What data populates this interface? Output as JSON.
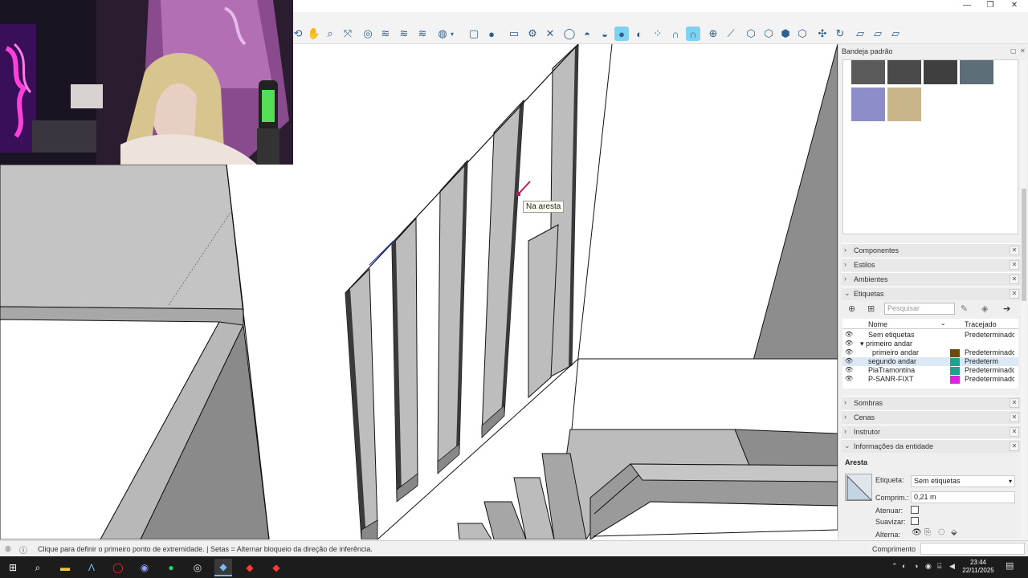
{
  "window": {
    "minimize_glyph": "—",
    "restore_glyph": "❐",
    "close_glyph": "✕"
  },
  "toolbar": {
    "icons": [
      "orbit-icon",
      "pan-icon",
      "zoom-icon",
      "zoom-extents-icon",
      "section-plane-icon",
      "section-fill-icon",
      "display-section-icon",
      "section-cut-icon",
      "add-location-icon",
      "dropdown-icon",
      "component-icon",
      "user-icon",
      "rectangle-icon",
      "settings-icon",
      "close-icon",
      "xray-icon",
      "back-edges-icon",
      "wireframe-icon",
      "hidden-line-icon",
      "shaded-icon",
      "monochrome-icon",
      "sandbox-icon",
      "magnet-icon",
      "snap-icon",
      "add-icon",
      "measure-icon",
      "iso-view-icon",
      "top-view-icon",
      "front-view-icon",
      "right-view-icon",
      "axes-icon",
      "refresh-icon",
      "parallel-view-icon",
      "perspective-view-icon",
      "two-point-view-icon"
    ],
    "active_icon": "shaded-icon"
  },
  "viewport": {
    "tooltip": "Na aresta"
  },
  "panel": {
    "title": "Bandeja padrão",
    "sections_top": [
      {
        "label": "Componentes",
        "expanded": false
      },
      {
        "label": "Estilos",
        "expanded": false
      },
      {
        "label": "Ambientes",
        "expanded": false
      },
      {
        "label": "Etiquetas",
        "expanded": true
      }
    ],
    "tags": {
      "search_placeholder": "Pesquisar",
      "col_name": "Nome",
      "col_dash": "Tracejado",
      "rows": [
        {
          "name": "Sem etiquetas",
          "dash": "Predeterminado",
          "color": "",
          "indent": 0,
          "selected": false
        },
        {
          "name": "▾ primeiro andar",
          "dash": "",
          "color": "",
          "indent": 0,
          "selected": false
        },
        {
          "name": "primeiro andar",
          "dash": "Predeterminado",
          "color": "#6b4a10",
          "indent": 1,
          "selected": false
        },
        {
          "name": "segundo andar",
          "dash": "Predeterm",
          "color": "#1aa58a",
          "indent": 0,
          "selected": true
        },
        {
          "name": "PiaTramontina",
          "dash": "Predeterminado",
          "color": "#1aa58a",
          "indent": 0,
          "selected": false
        },
        {
          "name": "P-SANR-FIXT",
          "dash": "Predeterminado",
          "color": "#e020e0",
          "indent": 0,
          "selected": false
        }
      ]
    },
    "sections_bottom": [
      {
        "label": "Sombras",
        "expanded": false
      },
      {
        "label": "Cenas",
        "expanded": false
      },
      {
        "label": "Instrutor",
        "expanded": false
      },
      {
        "label": "Informações da entidade",
        "expanded": true
      }
    ],
    "entity": {
      "type": "Aresta",
      "label_tag": "Etiqueta:",
      "tag_value": "Sem etiquetas",
      "label_length": "Comprim.:",
      "length_value": "0,21 m",
      "label_soften": "Atenuar:",
      "label_smooth": "Suavizar:",
      "label_hidden": "Alterna:"
    }
  },
  "status": {
    "message": "Clique para definir o primeiro ponto de extremidade. | Setas = Alternar bloqueio da direção de inferência.",
    "measure_label": "Comprimento",
    "measure_value": ""
  },
  "taskbar": {
    "apps": [
      "windows-start-icon",
      "search-icon",
      "file-explorer-icon",
      "app-a-icon",
      "opera-icon",
      "discord-icon",
      "spotify-icon",
      "chrome-icon",
      "sketchup-icon",
      "app-red-1-icon",
      "app-red-2-icon"
    ],
    "active_app": "sketchup-icon",
    "time": "23:44",
    "date": "22/11/2025"
  }
}
